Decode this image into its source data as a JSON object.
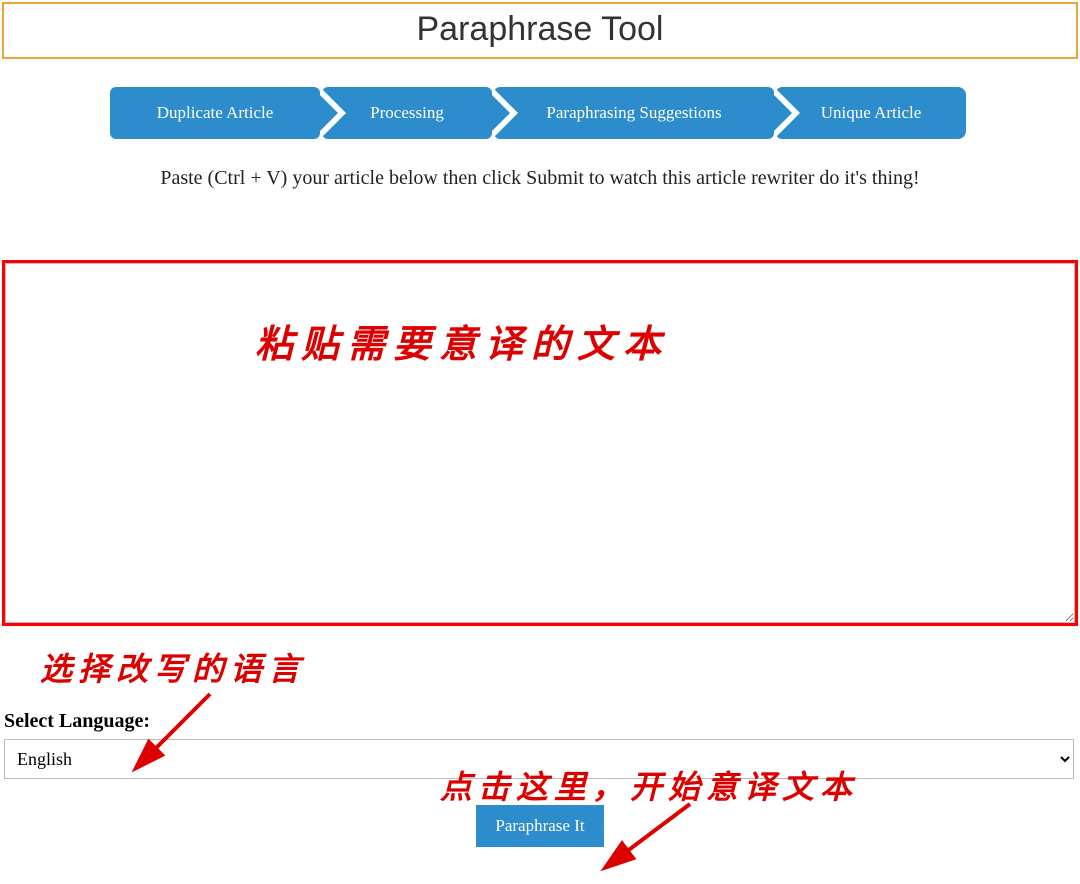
{
  "header": {
    "title": "Paraphrase Tool"
  },
  "steps": {
    "step1": "Duplicate Article",
    "step2": "Processing",
    "step3": "Paraphrasing Suggestions",
    "step4": "Unique Article"
  },
  "instruction": "Paste (Ctrl + V) your article below then click Submit to watch this article rewriter do it's thing!",
  "textarea": {
    "value": ""
  },
  "annotations": {
    "paste_note": "粘贴需要意译的文本",
    "select_language_note": "选择改写的语言",
    "click_here_note": "点击这里，开始意译文本"
  },
  "language": {
    "label": "Select Language:",
    "selected": "English"
  },
  "submit": {
    "label": "Paraphrase It"
  }
}
